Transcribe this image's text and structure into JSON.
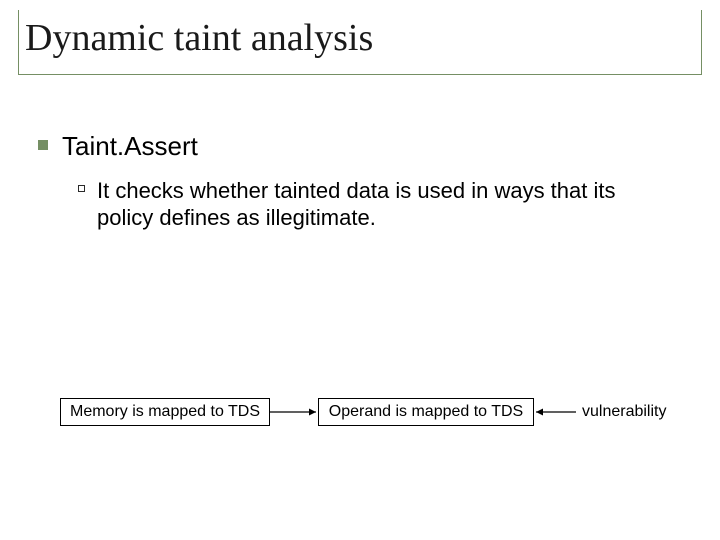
{
  "title": "Dynamic taint analysis",
  "bullets": {
    "lvl1": "Taint.Assert",
    "lvl2": "It checks whether tainted data is used in ways that its policy defines as illegitimate."
  },
  "diagram": {
    "box1": "Memory is mapped to TDS",
    "box2": "Operand is mapped to TDS",
    "label": "vulnerability"
  }
}
